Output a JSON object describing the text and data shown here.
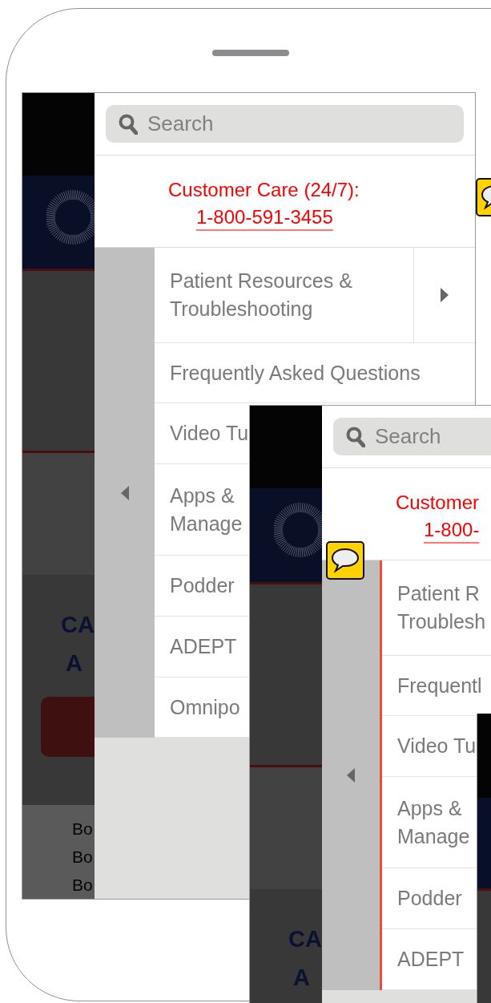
{
  "phone": {
    "screens": [
      {
        "site": {
          "heading": [
            "CA",
            "A"
          ],
          "body": [
            "Bo",
            "Bo",
            "Bo"
          ]
        },
        "menu": {
          "search_placeholder": "Search",
          "care_label": "Customer Care (24/7):",
          "care_phone": "1-800-591-3455",
          "back_highlighted": false,
          "items": [
            {
              "label": "Patient Resources &\nTroubleshooting",
              "has_submenu": true
            },
            {
              "label": "Frequently Asked Questions",
              "has_submenu": false
            },
            {
              "label": "Video Tu",
              "has_submenu": false
            },
            {
              "label": "Apps &\nManage",
              "has_submenu": false
            },
            {
              "label": "Podder",
              "has_submenu": false
            },
            {
              "label": "ADEPT",
              "has_submenu": false
            },
            {
              "label": "Omnipo",
              "has_submenu": false
            }
          ]
        }
      },
      {
        "site": {
          "heading": [
            "CA",
            "A"
          ]
        },
        "menu": {
          "search_placeholder": "Search",
          "care_label": "Customer",
          "care_phone": "1-800-",
          "back_highlighted": true,
          "items": [
            {
              "label": "Patient R\nTroublesh",
              "has_submenu": false
            },
            {
              "label": "Frequentl",
              "has_submenu": false
            },
            {
              "label": "Video Tu",
              "has_submenu": false
            },
            {
              "label": "Apps &\nManage",
              "has_submenu": false
            },
            {
              "label": "Podder",
              "has_submenu": false
            },
            {
              "label": "ADEPT",
              "has_submenu": false
            }
          ]
        }
      }
    ]
  }
}
